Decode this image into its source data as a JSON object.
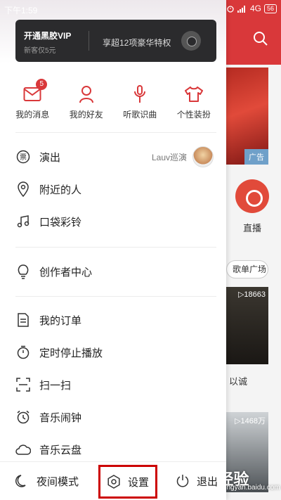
{
  "status_bar": {
    "time": "下午1:59",
    "network": "4G",
    "battery": "56"
  },
  "background_app": {
    "ad_tag": "广告",
    "live_label": "直播",
    "playlist_pill": "歌单广场",
    "thumb1_count": "▷18663",
    "thumb1_caption": "以诚",
    "thumb2_count": "▷1468万",
    "watermark": "Bai 经验",
    "watermark_sub": "jingyan.baidu.com"
  },
  "vip_card": {
    "title": "开通黑胶VIP",
    "subtitle": "新客仅5元",
    "perk": "享超12项豪华特权"
  },
  "quick_actions": [
    {
      "label": "我的消息",
      "icon": "mail-icon",
      "badge": "5"
    },
    {
      "label": "我的好友",
      "icon": "user-icon"
    },
    {
      "label": "听歌识曲",
      "icon": "mic-icon"
    },
    {
      "label": "个性装扮",
      "icon": "shirt-icon"
    }
  ],
  "menu_group1": [
    {
      "label": "演出",
      "icon": "ticket-icon",
      "extra": "Lauv巡演"
    },
    {
      "label": "附近的人",
      "icon": "location-icon"
    },
    {
      "label": "口袋彩铃",
      "icon": "music-note-icon"
    }
  ],
  "menu_group2": [
    {
      "label": "创作者中心",
      "icon": "bulb-icon"
    }
  ],
  "menu_group3": [
    {
      "label": "我的订单",
      "icon": "order-icon"
    },
    {
      "label": "定时停止播放",
      "icon": "timer-icon"
    },
    {
      "label": "扫一扫",
      "icon": "scan-icon"
    },
    {
      "label": "音乐闹钟",
      "icon": "alarm-icon"
    },
    {
      "label": "音乐云盘",
      "icon": "cloud-icon"
    }
  ],
  "bottom_bar": {
    "night_mode": "夜间模式",
    "settings": "设置",
    "exit": "退出"
  },
  "colors": {
    "brand_red": "#d9383a",
    "highlight_box": "#cc0000"
  }
}
